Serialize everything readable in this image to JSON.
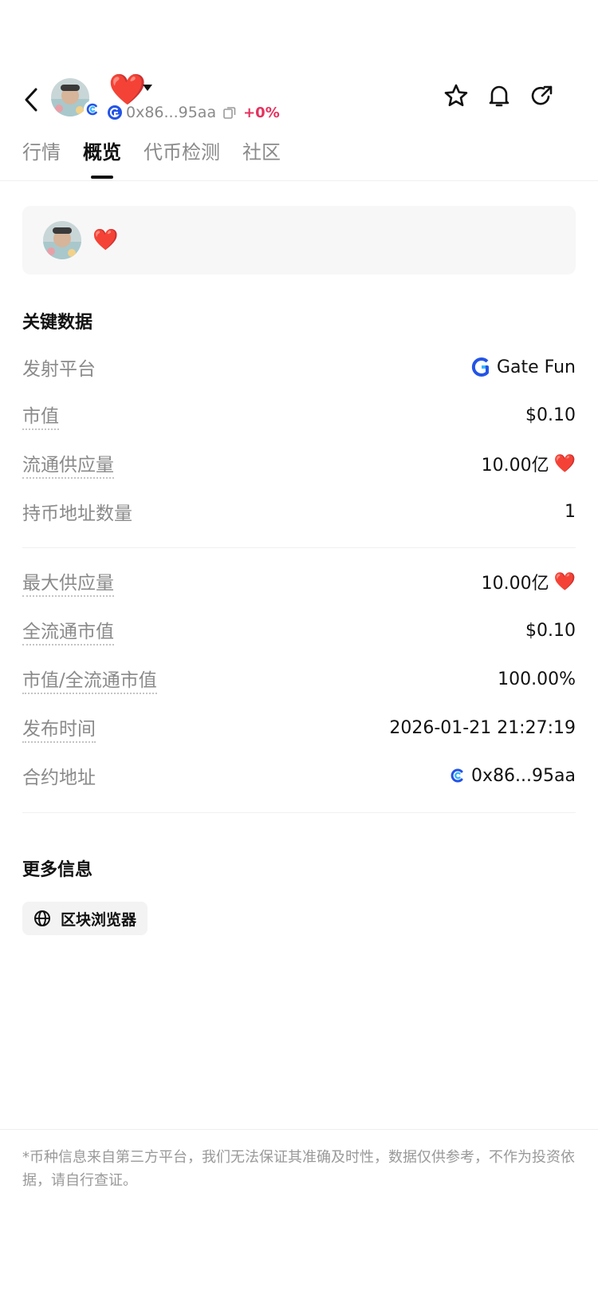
{
  "header": {
    "token_symbol": "❤️",
    "contract_short": "0x86...95aa",
    "price_change": "+0%",
    "icons": {
      "back": "chevron-left-icon",
      "caret": "caret-down-icon",
      "copy": "copy-icon",
      "star": "star-icon",
      "bell": "bell-icon",
      "share": "share-icon"
    }
  },
  "tabs": [
    {
      "label": "行情",
      "active": false
    },
    {
      "label": "概览",
      "active": true
    },
    {
      "label": "代币检测",
      "active": false
    },
    {
      "label": "社区",
      "active": false
    }
  ],
  "card": {
    "token_symbol": "❤️"
  },
  "key_data": {
    "title": "关键数据",
    "rows": [
      {
        "label": "发射平台",
        "value": "Gate Fun",
        "icon": "gate-fun-logo-icon"
      },
      {
        "label": "市值",
        "value": "$0.10"
      },
      {
        "label": "流通供应量",
        "value": "10.00亿",
        "suffix": "❤️"
      },
      {
        "label": "持币地址数量",
        "value": "1"
      }
    ],
    "rows2": [
      {
        "label": "最大供应量",
        "value": "10.00亿",
        "suffix": "❤️"
      },
      {
        "label": "全流通市值",
        "value": "$0.10"
      },
      {
        "label": "市值/全流通市值",
        "value": "100.00%"
      },
      {
        "label": "发布时间",
        "value": "2026-01-21 21:27:19"
      },
      {
        "label": "合约地址",
        "value": "0x86...95aa",
        "icon": "chain-icon"
      }
    ]
  },
  "more_info": {
    "title": "更多信息",
    "explorer_label": "区块浏览器"
  },
  "disclaimer": "*币种信息来自第三方平台，我们无法保证其准确及时性，数据仅供参考，不作为投资依据，请自行查证。",
  "colors": {
    "accent_red": "#e6315e",
    "heart_red": "#e52b3a",
    "gate_blue": "#2354e6",
    "text_muted": "#8a8a8a"
  }
}
